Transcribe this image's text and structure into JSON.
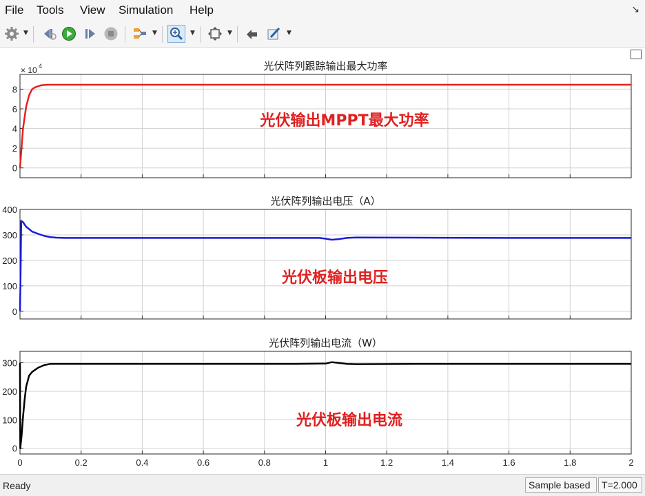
{
  "menu": {
    "items": [
      "File",
      "Tools",
      "View",
      "Simulation",
      "Help"
    ],
    "corner_arrow": "↘"
  },
  "toolbar": {
    "icons": [
      "gear-icon",
      "step-back-icon",
      "run-icon",
      "step-forward-icon",
      "stop-icon",
      "signal-selector-icon",
      "zoom-icon",
      "fit-to-view-icon",
      "highlight-block-icon",
      "style-pen-icon"
    ]
  },
  "status": {
    "ready": "Ready",
    "sample_mode": "Sample based",
    "time": "T=2.000"
  },
  "chart_data": [
    {
      "type": "line",
      "title": "光伏阵列跟踪输出最大功率",
      "exponent_label": "× 10",
      "exponent_power": "4",
      "annotation": "光伏输出MPPT最大功率",
      "annotation_color": "#e02020",
      "xlim": [
        0,
        2
      ],
      "ylim": [
        -1,
        9.5
      ],
      "yticks": [
        0,
        2,
        4,
        6,
        8
      ],
      "ytick_labels": [
        "0",
        "2",
        "4",
        "6",
        "8"
      ],
      "grid": true,
      "series": [
        {
          "color": "#e8201c",
          "x": [
            0,
            0.005,
            0.01,
            0.02,
            0.03,
            0.04,
            0.05,
            0.07,
            0.09,
            0.12,
            0.5,
            1.0,
            1.5,
            2.0
          ],
          "y": [
            0,
            2.0,
            4.0,
            6.2,
            7.4,
            8.0,
            8.2,
            8.4,
            8.45,
            8.45,
            8.45,
            8.45,
            8.45,
            8.45
          ]
        }
      ]
    },
    {
      "type": "line",
      "title": "光伏阵列输出电压（A）",
      "annotation": "光伏板输出电压",
      "annotation_color": "#e02020",
      "xlim": [
        0,
        2
      ],
      "ylim": [
        -30,
        400
      ],
      "yticks": [
        0,
        100,
        200,
        300,
        400
      ],
      "ytick_labels": [
        "0",
        "100",
        "200",
        "300",
        "400"
      ],
      "grid": true,
      "series": [
        {
          "color": "#1a1ad6",
          "x": [
            0,
            0.002,
            0.004,
            0.01,
            0.02,
            0.04,
            0.06,
            0.08,
            0.1,
            0.12,
            0.15,
            0.3,
            0.6,
            0.9,
            0.98,
            1.0,
            1.02,
            1.04,
            1.07,
            1.1,
            1.3,
            1.6,
            2.0
          ],
          "y": [
            0,
            150,
            355,
            350,
            332,
            313,
            304,
            296,
            291,
            289,
            288,
            288,
            288,
            288,
            288,
            285,
            281,
            283,
            288,
            290,
            289,
            288,
            288
          ]
        }
      ]
    },
    {
      "type": "line",
      "title": "光伏阵列输出电流（W）",
      "annotation": "光伏板输出电流",
      "annotation_color": "#e02020",
      "xlim": [
        0,
        2
      ],
      "ylim": [
        -20,
        340
      ],
      "yticks": [
        0,
        100,
        200,
        300
      ],
      "ytick_labels": [
        "0",
        "100",
        "200",
        "300"
      ],
      "xticks": [
        0,
        0.2,
        0.4,
        0.6,
        0.8,
        1,
        1.2,
        1.4,
        1.6,
        1.8,
        2
      ],
      "xtick_labels": [
        "0",
        "0.2",
        "0.4",
        "0.6",
        "0.8",
        "1",
        "1.2",
        "1.4",
        "1.6",
        "1.8",
        "2"
      ],
      "grid": true,
      "series": [
        {
          "color": "#000000",
          "x": [
            0,
            0.001,
            0.005,
            0.01,
            0.015,
            0.02,
            0.03,
            0.04,
            0.06,
            0.08,
            0.1,
            0.13,
            0.3,
            0.6,
            0.9,
            1.0,
            1.02,
            1.04,
            1.07,
            1.1,
            1.3,
            1.6,
            2.0
          ],
          "y": [
            300,
            0,
            40,
            110,
            170,
            215,
            255,
            268,
            283,
            292,
            296,
            296,
            296,
            296,
            296,
            297,
            302,
            300,
            296,
            295,
            296,
            296,
            296
          ]
        }
      ]
    }
  ]
}
